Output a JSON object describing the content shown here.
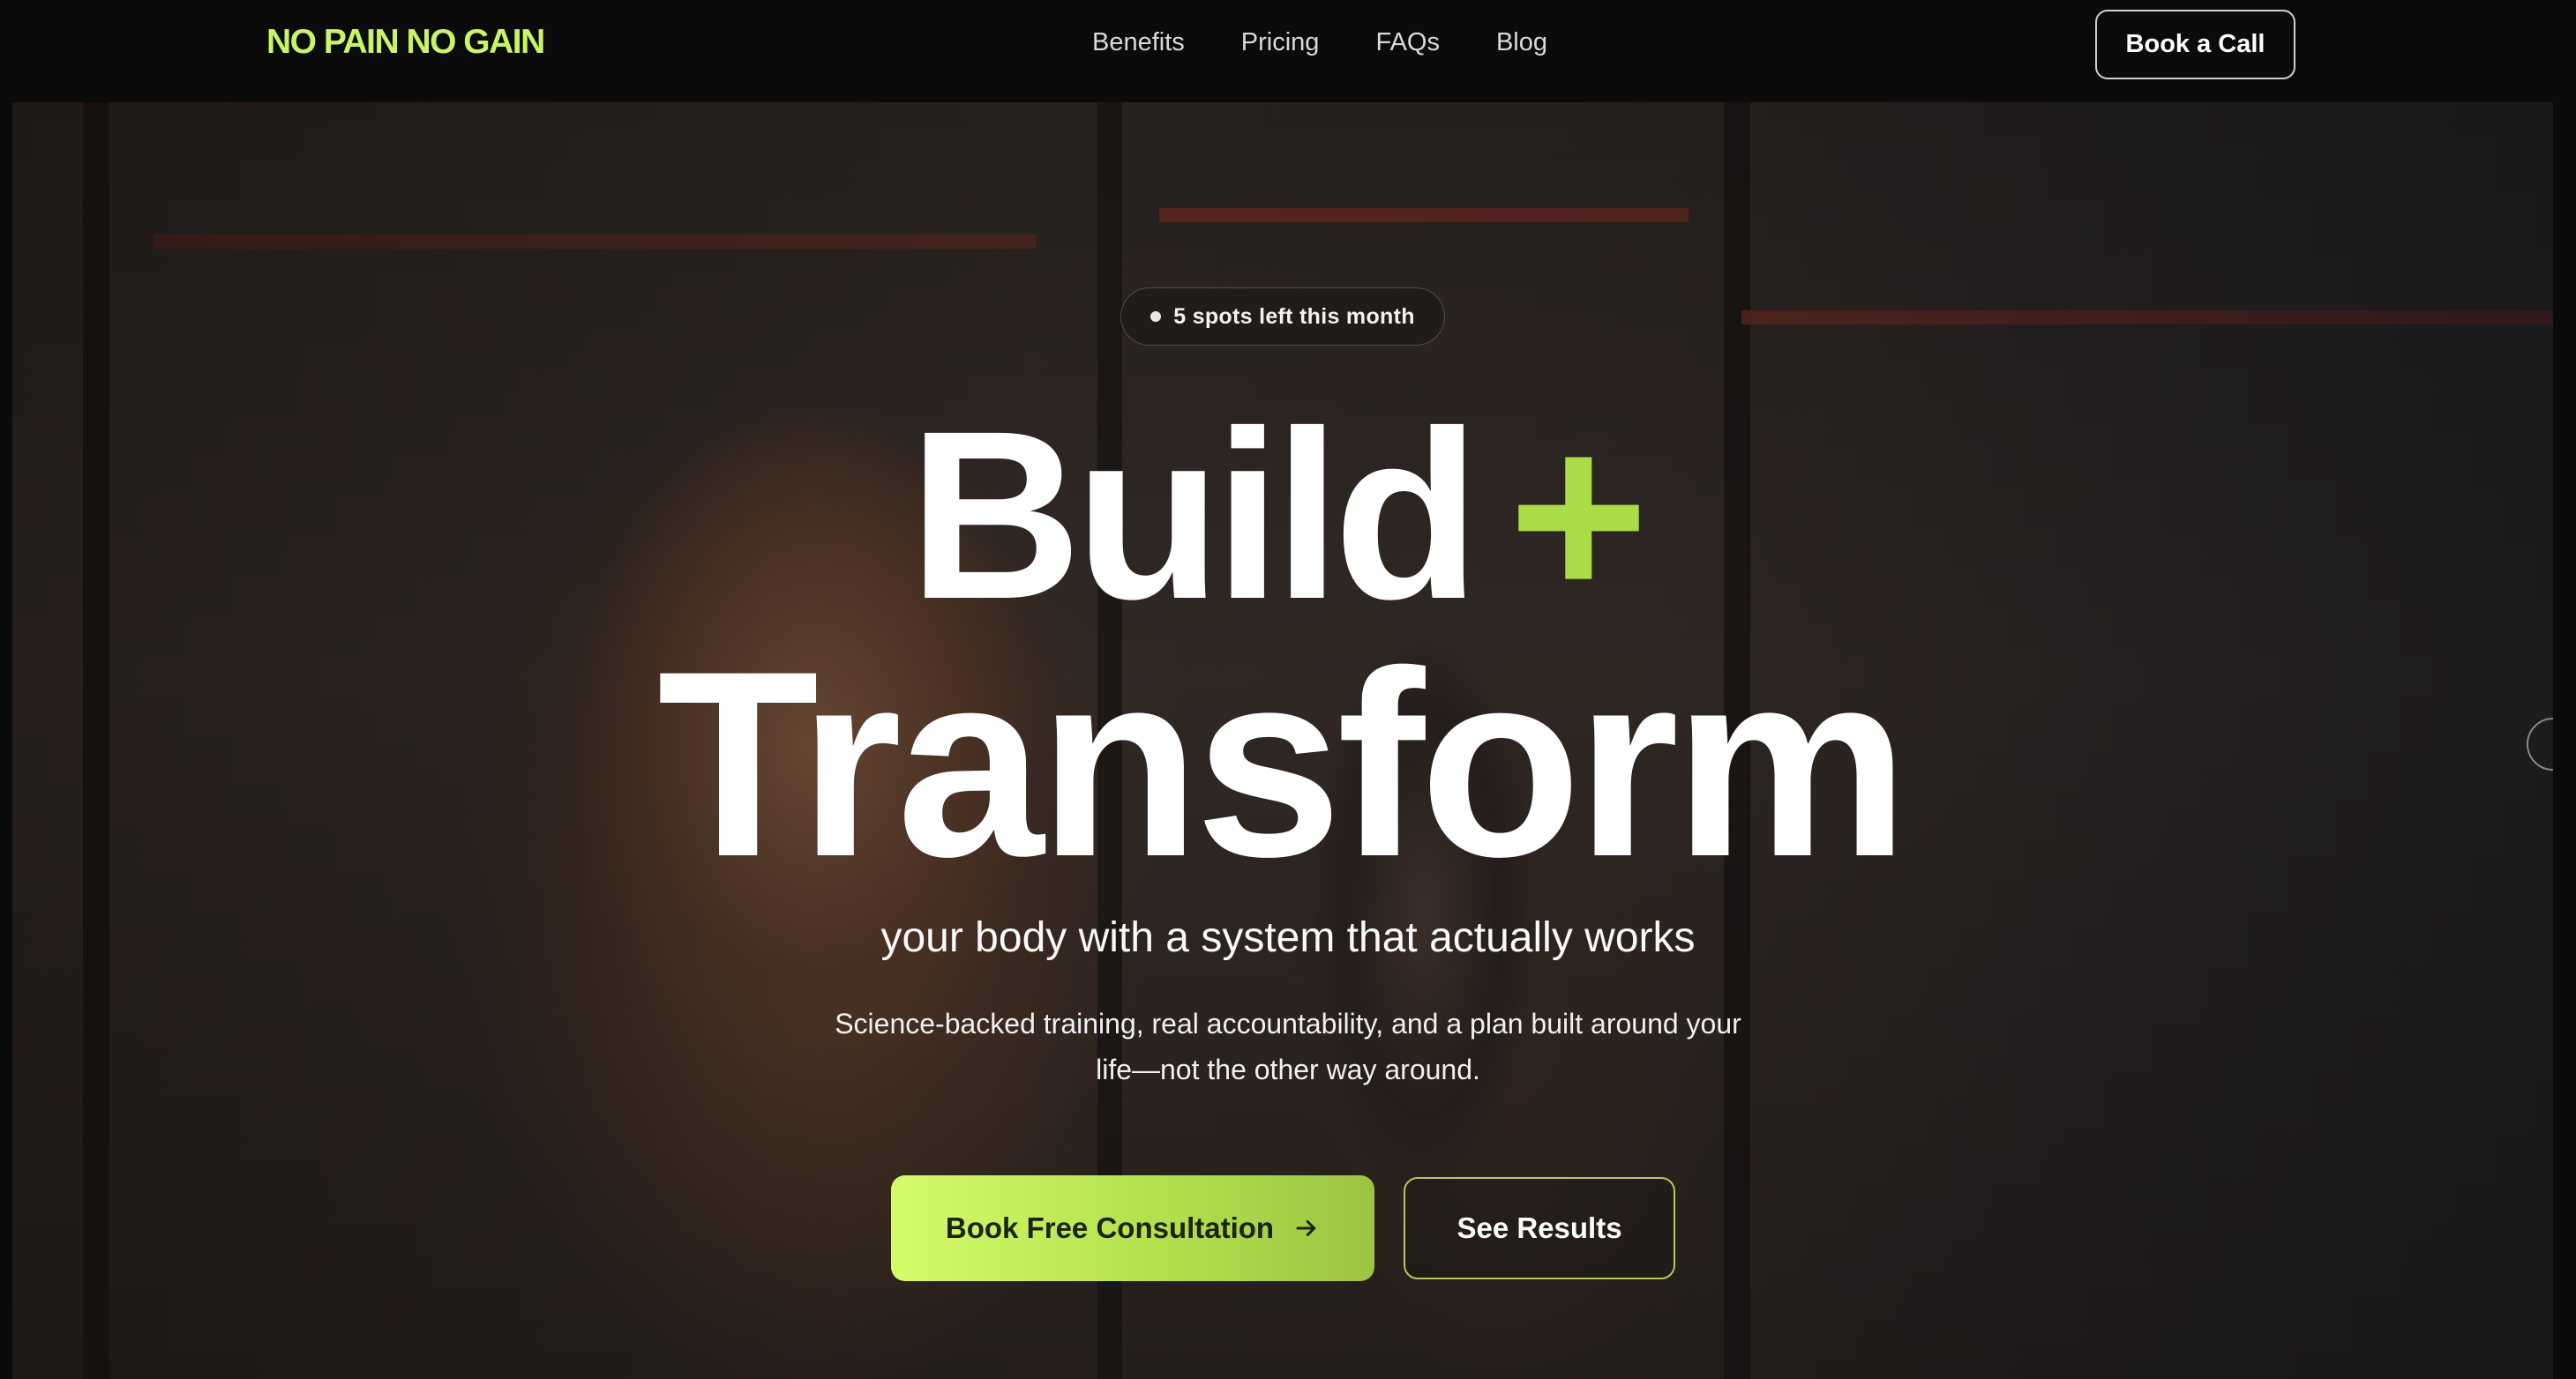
{
  "nav": {
    "brand": "NO PAIN NO GAIN",
    "links": [
      "Benefits",
      "Pricing",
      "FAQs",
      "Blog"
    ],
    "cta_label": "Book a Call"
  },
  "hero": {
    "badge_text": "5 spots left this month",
    "headline_word1": "Build",
    "headline_symbol": "+",
    "headline_word2": "Transform",
    "subheadline": "your body with a system that actually works",
    "description": "Science-backed training, real accountability, and a plan built around your life—not the other way around.",
    "primary_cta_label": "Book Free Consultation",
    "primary_cta_icon": "arrow-right-icon",
    "secondary_cta_label": "See Results"
  },
  "colors": {
    "accent": "#c8f46a",
    "accent_plus": "#a9dc47",
    "nav_bg": "#0b0b0b"
  }
}
